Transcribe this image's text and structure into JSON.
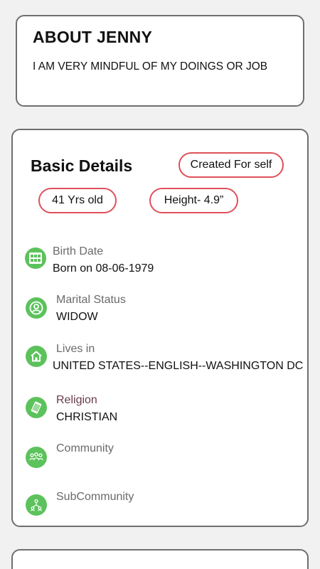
{
  "about": {
    "title": "ABOUT JENNY",
    "text": "I AM VERY MINDFUL OF MY DOINGS OR JOB"
  },
  "basic_details": {
    "title": "Basic Details",
    "created_for": "Created For self",
    "age": "41 Yrs old",
    "height": "Height- 4.9”",
    "rows": [
      {
        "icon": "calendar-icon",
        "label": "Birth Date",
        "value": "Born on 08-06-1979"
      },
      {
        "icon": "user-circle-icon",
        "label": "Marital Status",
        "value": "WIDOW"
      },
      {
        "icon": "home-icon",
        "label": "Lives in",
        "value": "UNITED STATES--ENGLISH--WASHINGTON DC"
      },
      {
        "icon": "scripture-icon",
        "label": "Religion",
        "value": "CHRISTIAN"
      },
      {
        "icon": "community-icon",
        "label": "Community",
        "value": ""
      },
      {
        "icon": "subcommunity-icon",
        "label": "SubCommunity",
        "value": ""
      }
    ]
  },
  "colors": {
    "background": "#f1f1f1",
    "card_border": "#6f6f6f",
    "pill_border": "#e0505a",
    "icon_green": "#5cc25c",
    "label_gray": "#6a6a6a",
    "religion_label": "#6b3a4e"
  }
}
